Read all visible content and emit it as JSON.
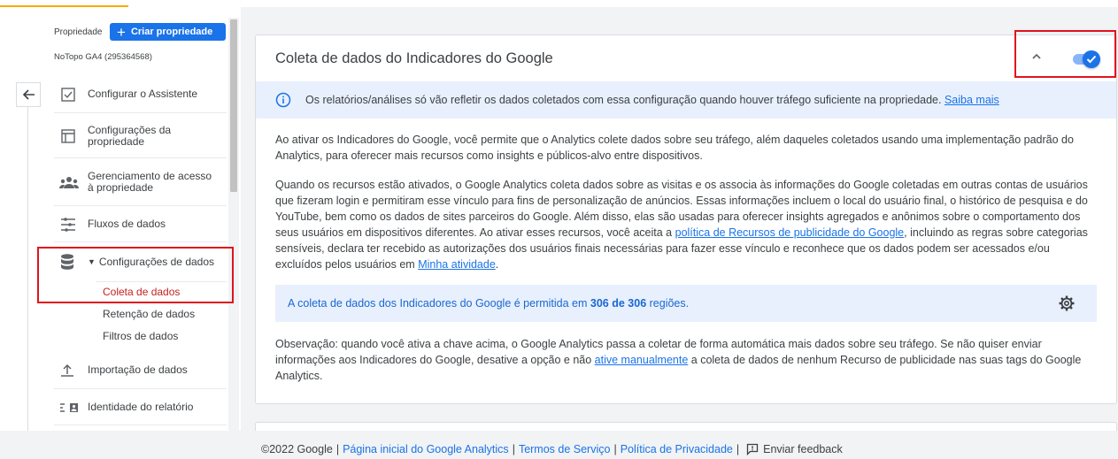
{
  "sidebar": {
    "property_label": "Propriedade",
    "create_button": "Criar propriedade",
    "property_name": "NoTopo GA4 (295364568)",
    "items": [
      {
        "label": "Configurar o Assistente",
        "icon": "checklist-icon"
      },
      {
        "label": "Configurações da propriedade",
        "icon": "property-layout-icon"
      },
      {
        "label": "Gerenciamento de acesso à propriedade",
        "icon": "people-icon"
      },
      {
        "label": "Fluxos de dados",
        "icon": "data-streams-icon"
      },
      {
        "label": "Configurações de dados",
        "icon": "database-icon"
      },
      {
        "label": "Importação de dados",
        "icon": "upload-icon"
      },
      {
        "label": "Identidade do relatório",
        "icon": "report-identity-icon"
      }
    ],
    "subitems": [
      "Coleta de dados",
      "Retenção de dados",
      "Filtros de dados"
    ]
  },
  "card": {
    "title": "Coleta de dados do Indicadores do Google",
    "toggle_on": true,
    "info": {
      "text": "Os relatórios/análises só vão refletir os dados coletados com essa configuração quando houver tráfego suficiente na propriedade.",
      "link": "Saiba mais"
    },
    "para1": "Ao ativar os Indicadores do Google, você permite que o Analytics colete dados sobre seu tráfego, além daqueles coletados usando uma implementação padrão do Analytics, para oferecer mais recursos como insights e públicos-alvo entre dispositivos.",
    "para2_a": "Quando os recursos estão ativados, o Google Analytics coleta dados sobre as visitas e os associa às informações do Google coletadas em outras contas de usuários que fizeram login e permitiram esse vínculo para fins de personalização de anúncios. Essas informações incluem o local do usuário final, o histórico de pesquisa e do YouTube, bem como os dados de sites parceiros do Google. Além disso, elas são usadas para oferecer insights agregados e anônimos sobre o comportamento dos seus usuários em dispositivos diferentes. Ao ativar esses recursos, você aceita a",
    "para2_link1": "política de Recursos de publicidade do Google",
    "para2_b": ", incluindo as regras sobre categorias sensíveis, declara ter recebido as autorizações dos usuários finais necessárias para fazer esse vínculo e reconhece que os dados podem ser acessados e/ou excluídos pelos usuários em",
    "para2_link2": "Minha atividade",
    "para2_c": ".",
    "regions_a": "A coleta de dados dos Indicadores do Google é permitida em",
    "regions_count": "306 de 306",
    "regions_b": "regiões.",
    "note_a": "Observação: quando você ativa a chave acima, o Google Analytics passa a coletar de forma automática mais dados sobre seu tráfego. Se não quiser enviar informações aos Indicadores do Google, desative a opção e não",
    "note_link": "ative manualmente",
    "note_b": "a coleta de dados de nenhum Recurso de publicidade nas suas tags do Google Analytics."
  },
  "footer": {
    "copyright": "©2022 Google",
    "links": [
      "Página inicial do Google Analytics",
      "Termos de Serviço",
      "Política de Privacidade"
    ],
    "feedback": "Enviar feedback"
  },
  "colors": {
    "accent": "#1a73e8",
    "active": "#c5221f",
    "highlight": "#e0141e"
  }
}
